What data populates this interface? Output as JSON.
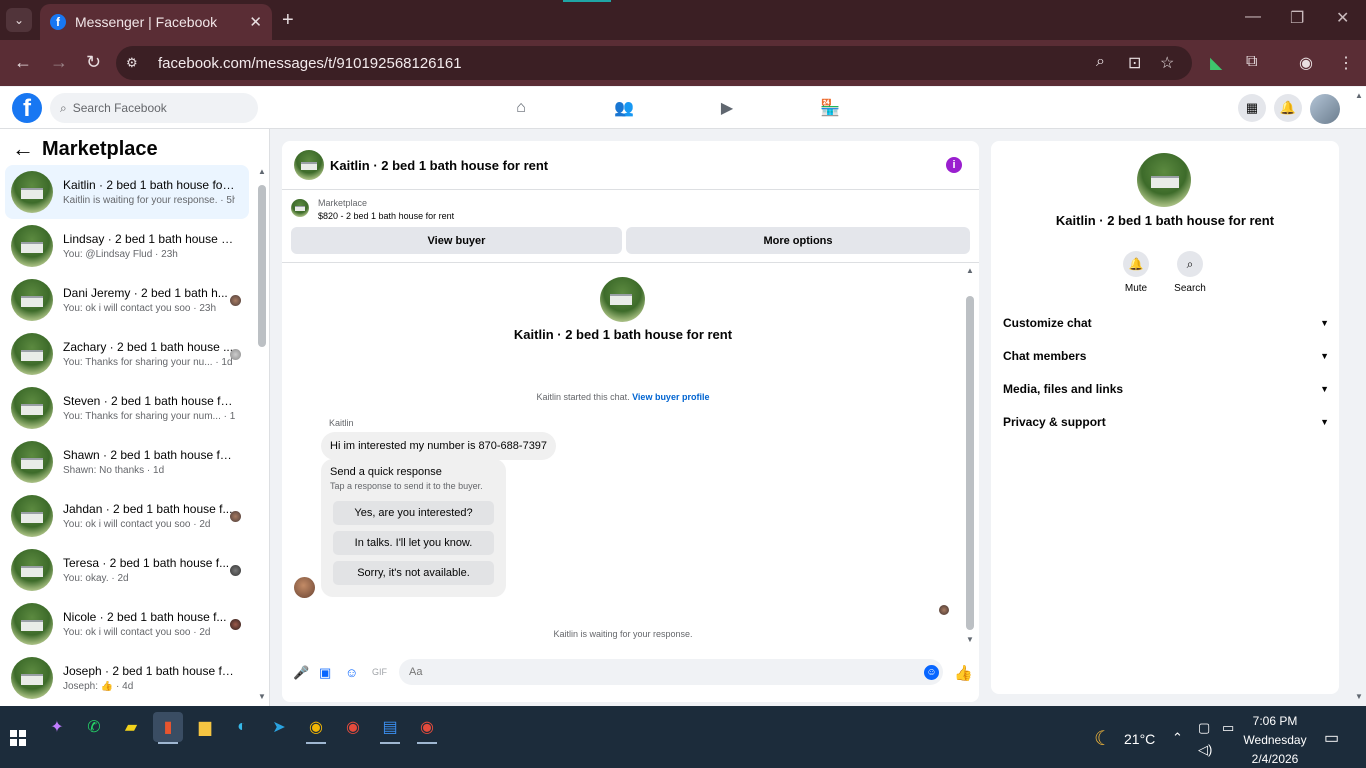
{
  "browser": {
    "tab_title": "Messenger | Facebook",
    "url": "facebook.com/messages/t/910192568126161",
    "tab_dropdown": "⌄",
    "new_tab": "+",
    "close": "✕"
  },
  "fb": {
    "search_placeholder": "Search Facebook"
  },
  "sidebar": {
    "title": "Marketplace",
    "conversations": [
      {
        "name": "Kaitlin · 2 bed 1 bath house for ...",
        "preview": "Kaitlin is waiting for your response. · 5h"
      },
      {
        "name": "Lindsay · 2 bed 1 bath house for...",
        "preview": "You: @Lindsay Flud · 23h"
      },
      {
        "name": "Dani Jeremy · 2 bed 1 bath h...",
        "preview": "You: ok i will contact you soo · 23h"
      },
      {
        "name": "Zachary · 2 bed 1 bath house ...",
        "preview": "You: Thanks for sharing your nu... · 1d"
      },
      {
        "name": "Steven · 2 bed 1 bath house for ...",
        "preview": "You: Thanks for sharing your num... · 1d"
      },
      {
        "name": "Shawn · 2 bed 1 bath house for ...",
        "preview": "Shawn: No thanks · 1d"
      },
      {
        "name": "Jahdan · 2 bed 1 bath house f...",
        "preview": "You: ok i will contact you soo · 2d"
      },
      {
        "name": "Teresa · 2 bed 1 bath house f...",
        "preview": "You: okay. · 2d"
      },
      {
        "name": "Nicole · 2 bed 1 bath house f...",
        "preview": "You: ok i will contact you soo · 2d"
      },
      {
        "name": "Joseph · 2 bed 1 bath house for ...",
        "preview": "Joseph: 👍 · 4d"
      }
    ]
  },
  "chat": {
    "title": "Kaitlin · 2 bed 1 bath house for rent",
    "listing_label": "Marketplace",
    "listing_price": "$820 - 2 bed 1 bath house for rent",
    "view_buyer": "View buyer",
    "more_options": "More options",
    "center_title": "Kaitlin · 2 bed 1 bath house for rent",
    "system_note": "Kaitlin started this chat.",
    "system_link": "View buyer profile",
    "sender": "Kaitlin",
    "message": "Hi im interested my number is 870-688-7397",
    "quick_title": "Send a quick response",
    "quick_sub": "Tap a response to send it to the buyer.",
    "quick_replies": [
      "Yes, are you interested?",
      "In talks. I'll let you know.",
      "Sorry, it's not available."
    ],
    "waiting": "Kaitlin is waiting for your response.",
    "composer_placeholder": "Aa"
  },
  "right_panel": {
    "title": "Kaitlin · 2 bed 1 bath house for rent",
    "mute": "Mute",
    "search": "Search",
    "sections": [
      "Customize chat",
      "Chat members",
      "Media, files and links",
      "Privacy & support"
    ]
  },
  "taskbar": {
    "temperature": "21°C",
    "time": "7:06 PM",
    "day": "Wednesday",
    "date": "2/4/2026"
  },
  "colors": {
    "accent": "#1877f2",
    "messenger_blue": "#0866ff",
    "info_purple": "#9a1fcf"
  }
}
